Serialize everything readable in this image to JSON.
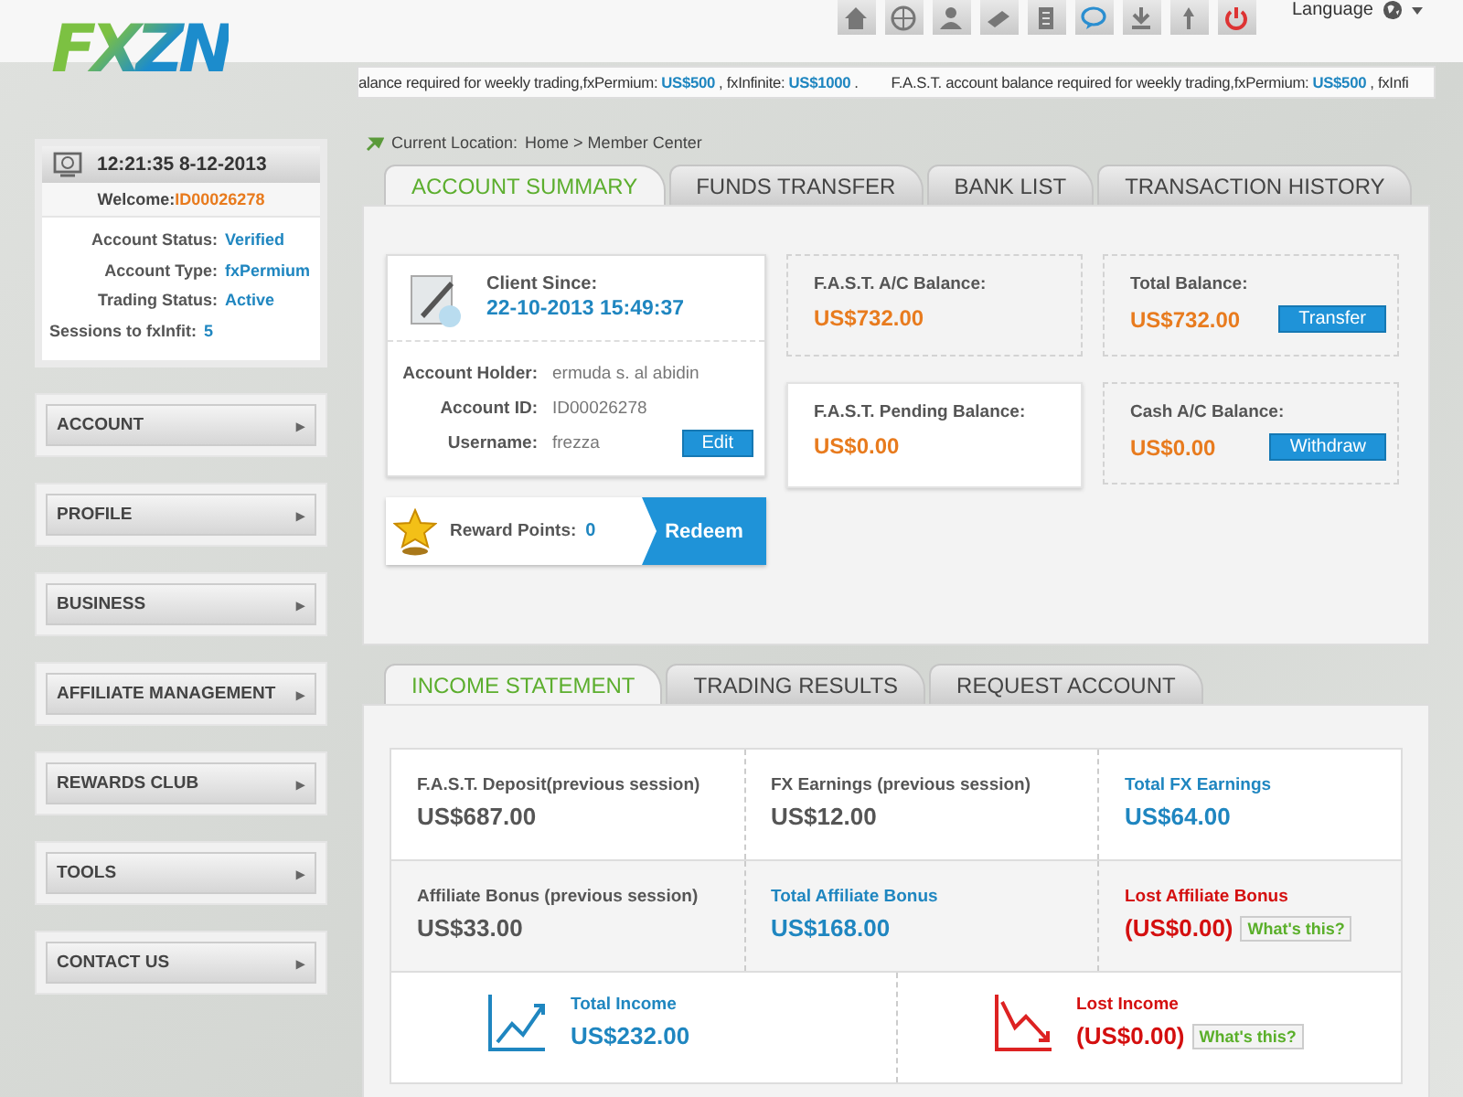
{
  "header": {
    "logo": "FXZN",
    "language": "Language",
    "ticker": [
      {
        "kind": "text",
        "text": "alance required for weekly trading,fxPermium:"
      },
      {
        "kind": "amount",
        "text": "US$500"
      },
      {
        "kind": "text",
        "text": ", fxInfinite:"
      },
      {
        "kind": "amount",
        "text": "US$1000"
      },
      {
        "kind": "text",
        "text": "."
      },
      {
        "kind": "gap",
        "text": "F.A.S.T. account balance required for weekly trading,fxPermium:"
      },
      {
        "kind": "amount",
        "text": "US$500"
      },
      {
        "kind": "text",
        "text": ", fxInfi"
      }
    ]
  },
  "sidebar": {
    "clock": "12:21:35 8-12-2013",
    "welcome": {
      "label": "Welcome:",
      "value": "ID00026278"
    },
    "status": [
      {
        "label": "Account Status:",
        "value": "Verified"
      },
      {
        "label": "Account Type:",
        "value": "fxPermium"
      },
      {
        "label": "Trading Status:",
        "value": "Active"
      },
      {
        "label": "Sessions to fxInfit:",
        "value": "5"
      }
    ],
    "menu": [
      {
        "label": "ACCOUNT",
        "icon": "▸"
      },
      {
        "label": "PROFILE",
        "icon": "▸"
      },
      {
        "label": "BUSINESS",
        "icon": "▸"
      },
      {
        "label": "AFFILIATE MANAGEMENT",
        "icon": "▸"
      },
      {
        "label": "REWARDS CLUB",
        "icon": "▸"
      },
      {
        "label": "TOOLS",
        "icon": "▸"
      },
      {
        "label": "CONTACT US",
        "icon": "▸"
      }
    ]
  },
  "breadcrumb": {
    "label": "Current Location:",
    "path": "Home >  Member Center"
  },
  "tabs": [
    {
      "label": "ACCOUNT SUMMARY",
      "selected": true
    },
    {
      "label": "FUNDS TRANSFER",
      "selected": false
    },
    {
      "label": "BANK LIST",
      "selected": false
    },
    {
      "label": "TRANSACTION HISTORY",
      "selected": false
    }
  ],
  "summary": {
    "client": {
      "label": "Client Since:",
      "value": "22-10-2013 15:49:37"
    },
    "details": [
      {
        "label": "Account Holder:",
        "value": "ermuda s. al abidin"
      },
      {
        "label": "Account ID:",
        "value": "ID00026278"
      },
      {
        "label": "Username:",
        "value": "frezza",
        "button": "Edit"
      }
    ],
    "reward": {
      "label": "Reward Points:",
      "value": "0",
      "button": "Redeem"
    },
    "balances": [
      {
        "label": "F.A.S.T. A/C Balance:",
        "amount": "US$732.00",
        "dashed": true
      },
      {
        "label": "Total Balance:",
        "amount": "US$732.00",
        "button": "Transfer",
        "dashed": true
      },
      {
        "label": "F.A.S.T. Pending Balance:",
        "amount": "US$0.00",
        "dashed": false
      },
      {
        "label": "Cash A/C Balance:",
        "amount": "US$0.00",
        "button": "Withdraw",
        "dashed": true
      }
    ]
  },
  "income_tabs": [
    {
      "label": "INCOME STATEMENT",
      "selected": true
    },
    {
      "label": "TRADING RESULTS",
      "selected": false
    },
    {
      "label": "REQUEST ACCOUNT",
      "selected": false
    }
  ],
  "income": {
    "rows": [
      [
        {
          "label": "F.A.S.T. Deposit(previous session)",
          "amount": "US$687.00",
          "kind": "plain"
        },
        {
          "label": "FX Earnings (previous session)",
          "amount": "US$12.00",
          "kind": "plain"
        },
        {
          "label": "Total FX Earnings",
          "amount": "US$64.00",
          "kind": "total"
        }
      ],
      [
        {
          "label": "Affiliate Bonus (previous session)",
          "amount": "US$33.00",
          "kind": "plain"
        },
        {
          "label": "Total Affiliate Bonus",
          "amount": "US$168.00",
          "kind": "total"
        },
        {
          "label": "Lost Affiliate Bonus",
          "amount": "(US$0.00)",
          "kind": "lost",
          "help": "What's this?"
        }
      ]
    ],
    "totals": [
      {
        "label": "Total Income",
        "amount": "US$232.00",
        "kind": "up"
      },
      {
        "label": "Lost Income",
        "amount": "(US$0.00)",
        "kind": "down",
        "help": "What's this?"
      }
    ]
  }
}
